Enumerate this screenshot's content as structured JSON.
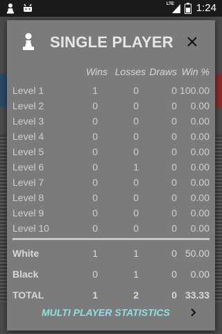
{
  "status_bar": {
    "time": "1:24",
    "network": "LTE"
  },
  "dialog": {
    "title": "SINGLE PLAYER",
    "columns": {
      "label": "",
      "wins": "Wins",
      "losses": "Losses",
      "draws": "Draws",
      "winpct": "Win %"
    },
    "levels": [
      {
        "label": "Level 1",
        "wins": "1",
        "losses": "0",
        "draws": "0",
        "winpct": "100.00"
      },
      {
        "label": "Level 2",
        "wins": "0",
        "losses": "0",
        "draws": "0",
        "winpct": "0.00"
      },
      {
        "label": "Level 3",
        "wins": "0",
        "losses": "0",
        "draws": "0",
        "winpct": "0.00"
      },
      {
        "label": "Level 4",
        "wins": "0",
        "losses": "0",
        "draws": "0",
        "winpct": "0.00"
      },
      {
        "label": "Level 5",
        "wins": "0",
        "losses": "0",
        "draws": "0",
        "winpct": "0.00"
      },
      {
        "label": "Level 6",
        "wins": "0",
        "losses": "1",
        "draws": "0",
        "winpct": "0.00"
      },
      {
        "label": "Level 7",
        "wins": "0",
        "losses": "0",
        "draws": "0",
        "winpct": "0.00"
      },
      {
        "label": "Level 8",
        "wins": "0",
        "losses": "0",
        "draws": "0",
        "winpct": "0.00"
      },
      {
        "label": "Level 9",
        "wins": "0",
        "losses": "0",
        "draws": "0",
        "winpct": "0.00"
      },
      {
        "label": "Level 10",
        "wins": "0",
        "losses": "0",
        "draws": "0",
        "winpct": "0.00"
      }
    ],
    "white": {
      "label": "White",
      "wins": "1",
      "losses": "1",
      "draws": "0",
      "winpct": "50.00"
    },
    "black": {
      "label": "Black",
      "wins": "0",
      "losses": "1",
      "draws": "0",
      "winpct": "0.00"
    },
    "total": {
      "label": "TOTAL",
      "wins": "1",
      "losses": "2",
      "draws": "0",
      "winpct": "33.33"
    },
    "multiplayer_link": "MULTI PLAYER STATISTICS"
  },
  "colors": {
    "dialog_bg": "#7b7b7b",
    "link": "#8fe0e0",
    "text": "#cfcfcf"
  },
  "icons": [
    "pawn-icon",
    "android-icon",
    "close-icon",
    "chevron-right-icon",
    "battery-icon",
    "signal-icon"
  ]
}
